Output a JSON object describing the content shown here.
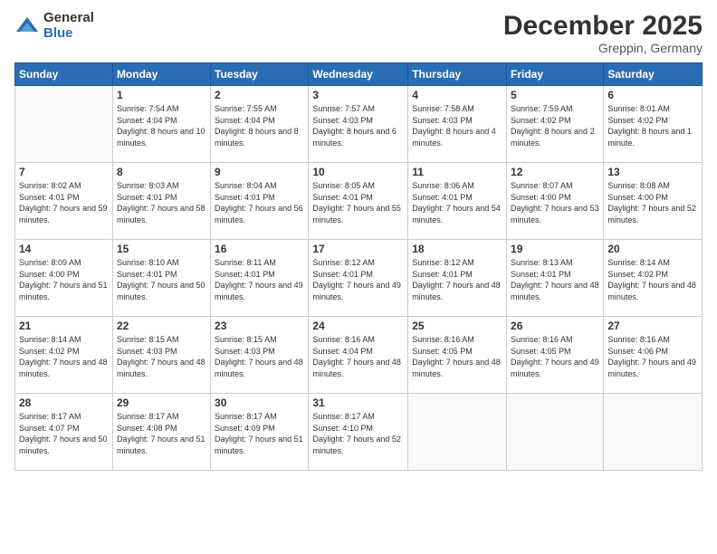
{
  "logo": {
    "general": "General",
    "blue": "Blue"
  },
  "header": {
    "title": "December 2025",
    "location": "Greppin, Germany"
  },
  "weekdays": [
    "Sunday",
    "Monday",
    "Tuesday",
    "Wednesday",
    "Thursday",
    "Friday",
    "Saturday"
  ],
  "weeks": [
    [
      {
        "day": "",
        "sunrise": "",
        "sunset": "",
        "daylight": ""
      },
      {
        "day": "1",
        "sunrise": "Sunrise: 7:54 AM",
        "sunset": "Sunset: 4:04 PM",
        "daylight": "Daylight: 8 hours and 10 minutes."
      },
      {
        "day": "2",
        "sunrise": "Sunrise: 7:55 AM",
        "sunset": "Sunset: 4:04 PM",
        "daylight": "Daylight: 8 hours and 8 minutes."
      },
      {
        "day": "3",
        "sunrise": "Sunrise: 7:57 AM",
        "sunset": "Sunset: 4:03 PM",
        "daylight": "Daylight: 8 hours and 6 minutes."
      },
      {
        "day": "4",
        "sunrise": "Sunrise: 7:58 AM",
        "sunset": "Sunset: 4:03 PM",
        "daylight": "Daylight: 8 hours and 4 minutes."
      },
      {
        "day": "5",
        "sunrise": "Sunrise: 7:59 AM",
        "sunset": "Sunset: 4:02 PM",
        "daylight": "Daylight: 8 hours and 2 minutes."
      },
      {
        "day": "6",
        "sunrise": "Sunrise: 8:01 AM",
        "sunset": "Sunset: 4:02 PM",
        "daylight": "Daylight: 8 hours and 1 minute."
      }
    ],
    [
      {
        "day": "7",
        "sunrise": "Sunrise: 8:02 AM",
        "sunset": "Sunset: 4:01 PM",
        "daylight": "Daylight: 7 hours and 59 minutes."
      },
      {
        "day": "8",
        "sunrise": "Sunrise: 8:03 AM",
        "sunset": "Sunset: 4:01 PM",
        "daylight": "Daylight: 7 hours and 58 minutes."
      },
      {
        "day": "9",
        "sunrise": "Sunrise: 8:04 AM",
        "sunset": "Sunset: 4:01 PM",
        "daylight": "Daylight: 7 hours and 56 minutes."
      },
      {
        "day": "10",
        "sunrise": "Sunrise: 8:05 AM",
        "sunset": "Sunset: 4:01 PM",
        "daylight": "Daylight: 7 hours and 55 minutes."
      },
      {
        "day": "11",
        "sunrise": "Sunrise: 8:06 AM",
        "sunset": "Sunset: 4:01 PM",
        "daylight": "Daylight: 7 hours and 54 minutes."
      },
      {
        "day": "12",
        "sunrise": "Sunrise: 8:07 AM",
        "sunset": "Sunset: 4:00 PM",
        "daylight": "Daylight: 7 hours and 53 minutes."
      },
      {
        "day": "13",
        "sunrise": "Sunrise: 8:08 AM",
        "sunset": "Sunset: 4:00 PM",
        "daylight": "Daylight: 7 hours and 52 minutes."
      }
    ],
    [
      {
        "day": "14",
        "sunrise": "Sunrise: 8:09 AM",
        "sunset": "Sunset: 4:00 PM",
        "daylight": "Daylight: 7 hours and 51 minutes."
      },
      {
        "day": "15",
        "sunrise": "Sunrise: 8:10 AM",
        "sunset": "Sunset: 4:01 PM",
        "daylight": "Daylight: 7 hours and 50 minutes."
      },
      {
        "day": "16",
        "sunrise": "Sunrise: 8:11 AM",
        "sunset": "Sunset: 4:01 PM",
        "daylight": "Daylight: 7 hours and 49 minutes."
      },
      {
        "day": "17",
        "sunrise": "Sunrise: 8:12 AM",
        "sunset": "Sunset: 4:01 PM",
        "daylight": "Daylight: 7 hours and 49 minutes."
      },
      {
        "day": "18",
        "sunrise": "Sunrise: 8:12 AM",
        "sunset": "Sunset: 4:01 PM",
        "daylight": "Daylight: 7 hours and 48 minutes."
      },
      {
        "day": "19",
        "sunrise": "Sunrise: 8:13 AM",
        "sunset": "Sunset: 4:01 PM",
        "daylight": "Daylight: 7 hours and 48 minutes."
      },
      {
        "day": "20",
        "sunrise": "Sunrise: 8:14 AM",
        "sunset": "Sunset: 4:02 PM",
        "daylight": "Daylight: 7 hours and 48 minutes."
      }
    ],
    [
      {
        "day": "21",
        "sunrise": "Sunrise: 8:14 AM",
        "sunset": "Sunset: 4:02 PM",
        "daylight": "Daylight: 7 hours and 48 minutes."
      },
      {
        "day": "22",
        "sunrise": "Sunrise: 8:15 AM",
        "sunset": "Sunset: 4:03 PM",
        "daylight": "Daylight: 7 hours and 48 minutes."
      },
      {
        "day": "23",
        "sunrise": "Sunrise: 8:15 AM",
        "sunset": "Sunset: 4:03 PM",
        "daylight": "Daylight: 7 hours and 48 minutes."
      },
      {
        "day": "24",
        "sunrise": "Sunrise: 8:16 AM",
        "sunset": "Sunset: 4:04 PM",
        "daylight": "Daylight: 7 hours and 48 minutes."
      },
      {
        "day": "25",
        "sunrise": "Sunrise: 8:16 AM",
        "sunset": "Sunset: 4:05 PM",
        "daylight": "Daylight: 7 hours and 48 minutes."
      },
      {
        "day": "26",
        "sunrise": "Sunrise: 8:16 AM",
        "sunset": "Sunset: 4:05 PM",
        "daylight": "Daylight: 7 hours and 49 minutes."
      },
      {
        "day": "27",
        "sunrise": "Sunrise: 8:16 AM",
        "sunset": "Sunset: 4:06 PM",
        "daylight": "Daylight: 7 hours and 49 minutes."
      }
    ],
    [
      {
        "day": "28",
        "sunrise": "Sunrise: 8:17 AM",
        "sunset": "Sunset: 4:07 PM",
        "daylight": "Daylight: 7 hours and 50 minutes."
      },
      {
        "day": "29",
        "sunrise": "Sunrise: 8:17 AM",
        "sunset": "Sunset: 4:08 PM",
        "daylight": "Daylight: 7 hours and 51 minutes."
      },
      {
        "day": "30",
        "sunrise": "Sunrise: 8:17 AM",
        "sunset": "Sunset: 4:09 PM",
        "daylight": "Daylight: 7 hours and 51 minutes."
      },
      {
        "day": "31",
        "sunrise": "Sunrise: 8:17 AM",
        "sunset": "Sunset: 4:10 PM",
        "daylight": "Daylight: 7 hours and 52 minutes."
      },
      {
        "day": "",
        "sunrise": "",
        "sunset": "",
        "daylight": ""
      },
      {
        "day": "",
        "sunrise": "",
        "sunset": "",
        "daylight": ""
      },
      {
        "day": "",
        "sunrise": "",
        "sunset": "",
        "daylight": ""
      }
    ]
  ]
}
